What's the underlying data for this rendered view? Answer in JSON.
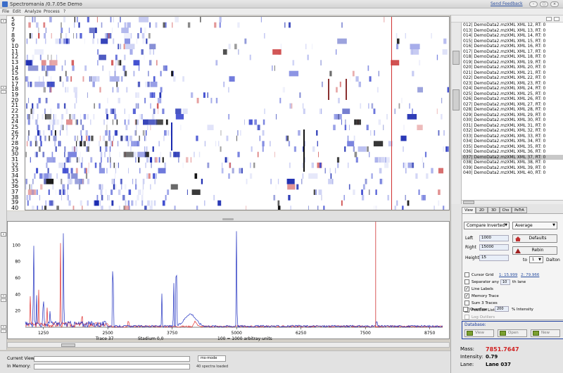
{
  "window": {
    "title": "Spectromania  /0.7.05e Demo",
    "feedback_link": "Send Feedback",
    "controls": [
      "–",
      "□",
      "×"
    ]
  },
  "menu": [
    "File",
    "Edit",
    "Analyze",
    "Process",
    "?"
  ],
  "lanes": {
    "labels": [
      "5",
      "6",
      "7",
      "8",
      "9",
      "10",
      "11",
      "12",
      "13",
      "14",
      "15",
      "16",
      "17",
      "18",
      "19",
      "20",
      "21",
      "22",
      "23",
      "24",
      "25",
      "26",
      "27",
      "28",
      "29",
      "30",
      "31",
      "32",
      "33",
      "34",
      "35",
      "36",
      "37",
      "38",
      "39",
      "40"
    ]
  },
  "spectrum": {
    "y_ticks": [
      "100",
      "80",
      "60",
      "40",
      "20"
    ],
    "x_ticks": [
      "1250",
      "2500",
      "3750",
      "5000",
      "6250",
      "7500",
      "8750"
    ],
    "trace_label": "Trace 37",
    "stadium_label": "Stadium 0,0",
    "units_label": "100 = 1000 arbitray units",
    "colors": {
      "memory_trace": "#e03030",
      "current_trace": "#2030c0",
      "cursor": "#d03030"
    }
  },
  "bottom": {
    "current_view_label": "Current View:",
    "in_memory_label": "In Memory:",
    "mode": "ms-mode",
    "spectra_loaded": "40  spectra loaded"
  },
  "lane_list": {
    "items": [
      "012| DemoData2.mzXML XML 12, RT: 0",
      "013| DemoData2.mzXML XML 13, RT: 0",
      "014| DemoData2.mzXML XML 14, RT: 0",
      "015| DemoData2.mzXML XML 15, RT: 0",
      "016| DemoData2.mzXML XML 16, RT: 0",
      "017| DemoData2.mzXML XML 17, RT: 0",
      "018| DemoData2.mzXML XML 18, RT: 0",
      "019| DemoData2.mzXML XML 19, RT: 0",
      "020| DemoData2.mzXML XML 20, RT: 0",
      "021| DemoData2.mzXML XML 21, RT: 0",
      "022| DemoData2.mzXML XML 22, RT: 0",
      "023| DemoData2.mzXML XML 23, RT: 0",
      "024| DemoData2.mzXML XML 24, RT: 0",
      "025| DemoData2.mzXML XML 25, RT: 0",
      "026| DemoData2.mzXML XML 26, RT: 0",
      "027| DemoData2.mzXML XML 27, RT: 0",
      "028| DemoData2.mzXML XML 28, RT: 0",
      "029| DemoData2.mzXML XML 29, RT: 0",
      "030| DemoData2.mzXML XML 30, RT: 0",
      "031| DemoData2.mzXML XML 31, RT: 0",
      "032| DemoData2.mzXML XML 32, RT: 0",
      "033| DemoData2.mzXML XML 33, RT: 0",
      "034| DemoData2.mzXML XML 34, RT: 0",
      "035| DemoData2.mzXML XML 35, RT: 0",
      "036| DemoData2.mzXML XML 36, RT: 0",
      "037| DemoData2.mzXML XML 37, RT: 0",
      "038| DemoData2.mzXML XML 38, RT: 0",
      "039| DemoData2.mzXML XML 39, RT: 0",
      "040| DemoData2.mzXML XML 40, RT: 0"
    ],
    "selected_index": 25
  },
  "tabs": [
    "View",
    "2D",
    "3D",
    "Cho",
    "PeTrA"
  ],
  "view": {
    "compare_mode": "Compare Inverted",
    "aggregate": "Average",
    "left_label": "Left",
    "left_value": "1000",
    "right_label": "Right",
    "right_value": "15000",
    "height_label": "Height",
    "height_value": "15",
    "defaults_button": "Defaults",
    "rebin_button": "Rebin",
    "to_label": "to",
    "to_value": "1",
    "dalton_label": "Dalton",
    "cursor_grid_label": "Cursor Grid",
    "cursor_grid_v1": "1: 15.999",
    "cursor_grid_v2": "2: 79.966",
    "separator_label": "Separator any",
    "separator_value": "10",
    "separator_suffix": "th lane",
    "line_labels": "Line Labels",
    "memory_trace": "Memory Trace",
    "sum3": "Sum 3 Traces",
    "position_list": "Position List",
    "log_outliers": "Log Outliers",
    "overflow_label": "Overflow",
    "overflow_value": "200",
    "overflow_suffix": "% Intensity",
    "checks": {
      "cursor_grid": false,
      "separator": false,
      "line_labels": true,
      "memory_trace": true,
      "sum3": false,
      "position_list": true,
      "log_outliers": false,
      "overflow": false
    },
    "check_mark": "✓"
  },
  "database": {
    "label": "Database:",
    "view": "View",
    "open": "Open",
    "new": "New"
  },
  "readout": {
    "mass_label": "Mass:",
    "mass_value": "7851.7647",
    "intensity_label": "Intensity:",
    "intensity_value": "0.79",
    "lane_label": "Lane:",
    "lane_value": "Lane 037"
  }
}
